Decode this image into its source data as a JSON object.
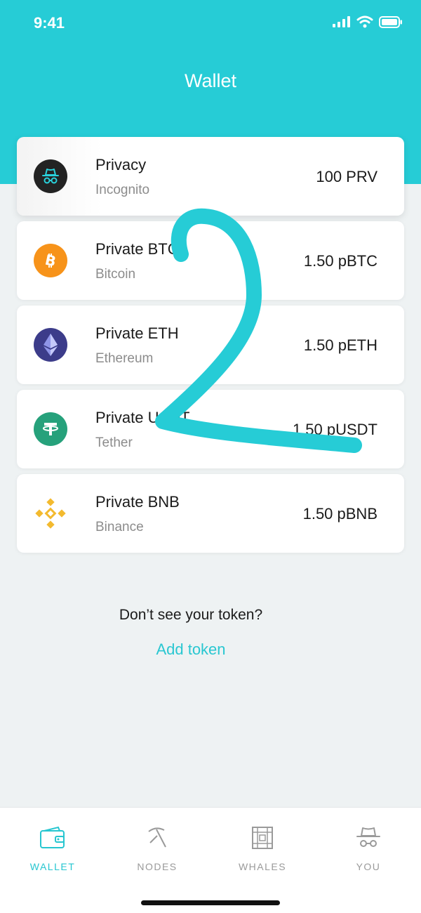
{
  "status": {
    "time": "9:41"
  },
  "header": {
    "title": "Wallet"
  },
  "tokens": [
    {
      "name": "Privacy",
      "network": "Incognito",
      "amount": "100 PRV",
      "icon": "incognito-icon"
    },
    {
      "name": "Private BTC",
      "network": "Bitcoin",
      "amount": "1.50 pBTC",
      "icon": "bitcoin-icon"
    },
    {
      "name": "Private ETH",
      "network": "Ethereum",
      "amount": "1.50 pETH",
      "icon": "ethereum-icon"
    },
    {
      "name": "Private USDT",
      "network": "Tether",
      "amount": "1.50 pUSDT",
      "icon": "tether-icon"
    },
    {
      "name": "Private BNB",
      "network": "Binance",
      "amount": "1.50 pBNB",
      "icon": "binance-icon"
    }
  ],
  "footer": {
    "question": "Don’t see your token?",
    "add_token": "Add token"
  },
  "tabs": [
    {
      "label": "WALLET",
      "icon": "wallet-icon",
      "active": true
    },
    {
      "label": "NODES",
      "icon": "pickaxe-icon",
      "active": false
    },
    {
      "label": "WHALES",
      "icon": "building-icon",
      "active": false
    },
    {
      "label": "YOU",
      "icon": "incognito-hat-icon",
      "active": false
    }
  ],
  "colors": {
    "accent": "#26ccd6",
    "bitcoin": "#f7931a",
    "ethereum": "#3c3c8a",
    "tether": "#26a17b",
    "binance": "#f3ba2f"
  }
}
